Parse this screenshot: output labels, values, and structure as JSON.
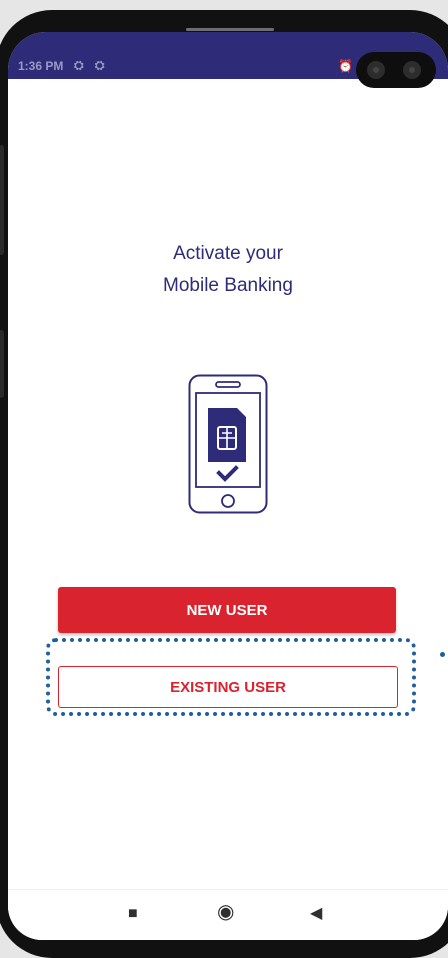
{
  "status_bar": {
    "time": "1:36 PM",
    "notification_icons": "⛭ ⛭",
    "alarm_glyph": "⏰"
  },
  "screen": {
    "title_line1": "Activate your",
    "title_line2": "Mobile Banking"
  },
  "buttons": {
    "new_user": "NEW USER",
    "existing_user": "EXISTING USER"
  },
  "nav_bar": {
    "recents_glyph": "■",
    "home_glyph": "◉",
    "back_glyph": "◀"
  },
  "colors": {
    "brand_navy": "#2e2c78",
    "brand_red": "#d9232e",
    "highlight_blue": "#1f5fa0"
  },
  "icons": {
    "illustration": "phone-sim-check-icon"
  }
}
